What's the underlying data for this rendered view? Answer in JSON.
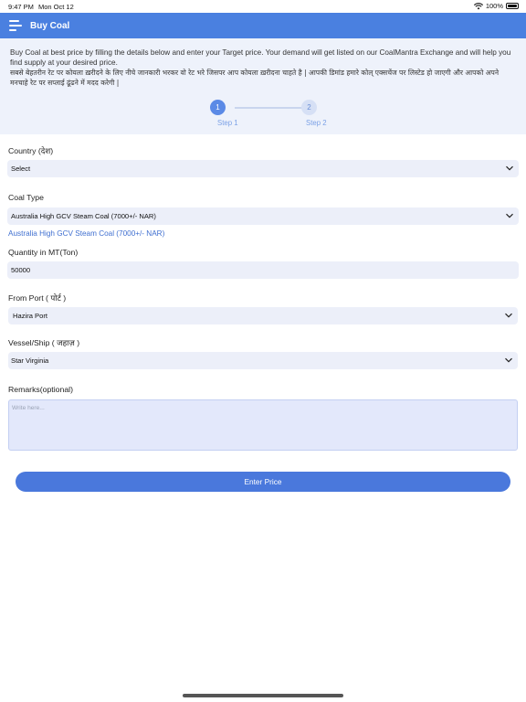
{
  "status_bar": {
    "time": "9:47 PM",
    "date": "Mon Oct 12",
    "battery": "100%"
  },
  "header": {
    "title": "Buy Coal"
  },
  "intro": {
    "english": "Buy Coal at best price by filling the details below and enter your Target price. Your demand will get listed on our CoalMantra Exchange and will help you find supply at your desired price.",
    "hindi": "सबसे बेहतरीन रेट पर कोयला ख़रीदने के लिए नीचे जानकारी भरकर वो रेट भरे जिसपर आप कोयला ख़रीदना चाहते है | आपकी डिमांड हमारे कोल् एक्सचेंज पर लिस्टेड हो जाएगी और आपको अपने मनचाहे रेट पर सप्लाई ढूंढने में मदद करेगी |"
  },
  "stepper": {
    "steps": [
      {
        "number": "1",
        "label": "Step 1",
        "active": true
      },
      {
        "number": "2",
        "label": "Step 2",
        "active": false
      }
    ]
  },
  "form": {
    "country": {
      "label": "Country (देश)",
      "value": "Select"
    },
    "coal_type": {
      "label": "Coal Type",
      "value": "Australia High GCV Steam Coal (7000+/- NAR)",
      "selected_hint": "Australia High GCV Steam Coal (7000+/- NAR)"
    },
    "quantity": {
      "label": "Quantity in MT(Ton)",
      "value": "50000"
    },
    "from_port": {
      "label": "From Port ( पोर्ट )",
      "value": "Hazira Port"
    },
    "vessel": {
      "label": "Vessel/Ship ( जहाज़ )",
      "value": "Star Virginia"
    },
    "remarks": {
      "label": "Remarks(optional)",
      "placeholder": "Write here..."
    }
  },
  "actions": {
    "enter_price": "Enter Price"
  },
  "colors": {
    "primary": "#4a80e0",
    "intro_bg": "#eef2fb",
    "field_bg": "#eceff9",
    "hint": "#3f6fd0"
  },
  "icons": {
    "menu": "menu-icon",
    "wifi": "wifi-icon",
    "battery": "battery-icon",
    "dropdown": "chevron-down-icon"
  }
}
